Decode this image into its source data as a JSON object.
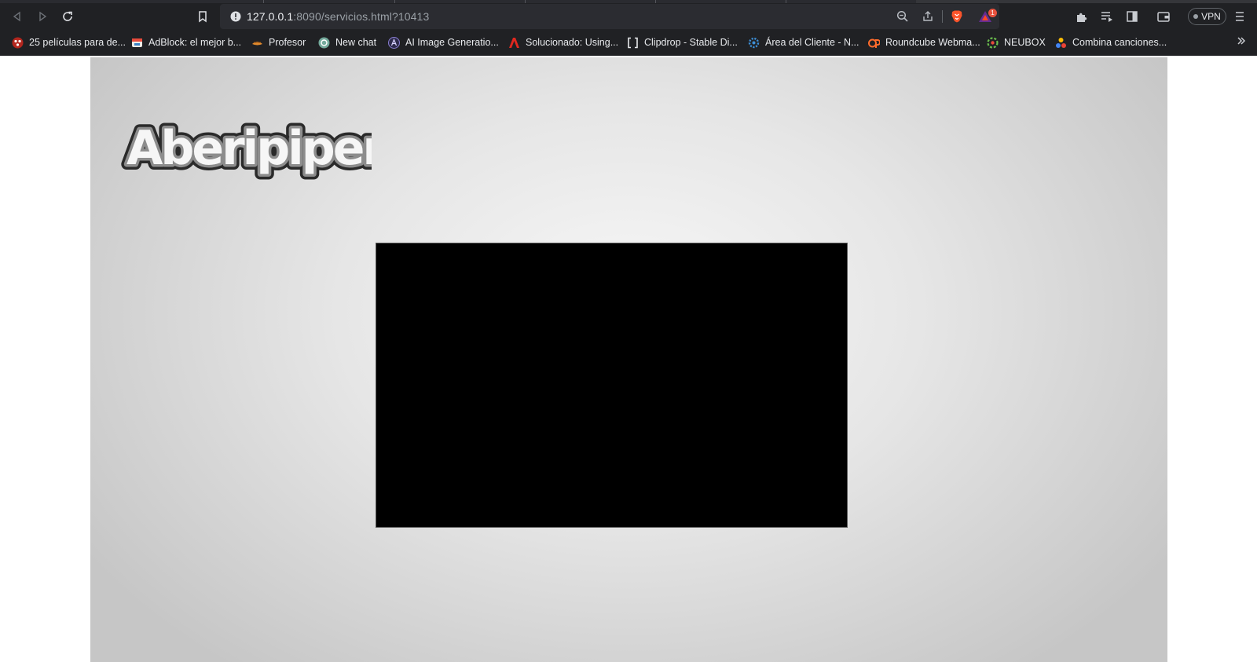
{
  "browser": {
    "url_host": "127.0.0.1",
    "url_rest": ":8090/servicios.html?10413",
    "shields_badge": "1",
    "vpn_label": "VPN",
    "more_bookmarks_icon": "chevron-double-right-icon"
  },
  "bookmarks": [
    {
      "label": "25 películas para de...",
      "icon": "movie-icon",
      "color": "#e0453a"
    },
    {
      "label": "AdBlock: el mejor b...",
      "icon": "adblock-icon",
      "color": "#e84b3c"
    },
    {
      "label": "Profesor",
      "icon": "profesor-icon",
      "color": "#e08a2e"
    },
    {
      "label": "New chat",
      "icon": "chatgpt-icon",
      "color": "#74aa9c"
    },
    {
      "label": "AI Image Generatio...",
      "icon": "ai-image-icon",
      "color": "#8a7fd4"
    },
    {
      "label": "Solucionado: Using...",
      "icon": "adobe-icon",
      "color": "#e0281f"
    },
    {
      "label": "Clipdrop - Stable Di...",
      "icon": "clipdrop-icon",
      "color": "#e8eaed"
    },
    {
      "label": "Área del Cliente - N...",
      "icon": "neubox-gear-icon",
      "color": "#3d8fd6"
    },
    {
      "label": "Roundcube Webma...",
      "icon": "cpanel-icon",
      "color": "#ff6c2c"
    },
    {
      "label": "NEUBOX",
      "icon": "neubox-icon",
      "color": "#6bbf4e"
    },
    {
      "label": "Combina canciones...",
      "icon": "combine-icon",
      "color": "#f4b400"
    }
  ],
  "page": {
    "logo_text": "Aberipiperi",
    "video_fill": "#000000"
  }
}
